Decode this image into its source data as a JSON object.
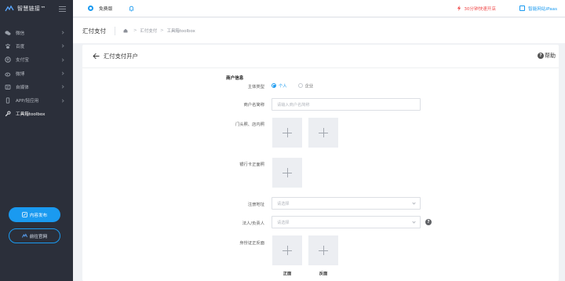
{
  "sidebar": {
    "brand": "智慧链接™",
    "items": [
      {
        "label": "微信",
        "icon": "wechat-icon"
      },
      {
        "label": "百度",
        "icon": "paw-icon"
      },
      {
        "label": "支付宝",
        "icon": "alipay-icon"
      },
      {
        "label": "微博",
        "icon": "weibo-icon"
      },
      {
        "label": "自媒体",
        "icon": "media-icon"
      },
      {
        "label": "APP/轻应用",
        "icon": "phone-icon"
      },
      {
        "label": "工具箱toolbox",
        "icon": "wrench-icon"
      }
    ],
    "publish_label": "内容发布",
    "official_label": "前往官网"
  },
  "topbar": {
    "plan_label": "免费版",
    "trial_label": "30分钟快速开店",
    "ipaas_label": "智能网站iPaas"
  },
  "titlebar": {
    "title": "汇付支付",
    "crumbs": [
      "汇付支付",
      "工具箱toolbox"
    ],
    "sep": ">"
  },
  "card": {
    "title": "汇付支付开户",
    "help_label": "帮助",
    "section": "商户信息",
    "subject_label": "主体类型",
    "subject_options": [
      "个人",
      "企业"
    ],
    "shop_name_label": "商户名简称",
    "shop_name_placeholder": "请输入商户名简称",
    "storefront_label": "门头照、店内照",
    "bank_card_label": "银行卡正面照",
    "address_label": "注册地址",
    "address_placeholder": "请选择",
    "legal_label": "法人/负责人",
    "legal_placeholder": "请选择",
    "id_card_label": "身份证正反面",
    "id_front_caption": "正面",
    "id_back_caption": "反面"
  },
  "colors": {
    "accent": "#1a9af0",
    "sidebar_bg": "#2b2f3a",
    "danger": "#f04b4b"
  }
}
